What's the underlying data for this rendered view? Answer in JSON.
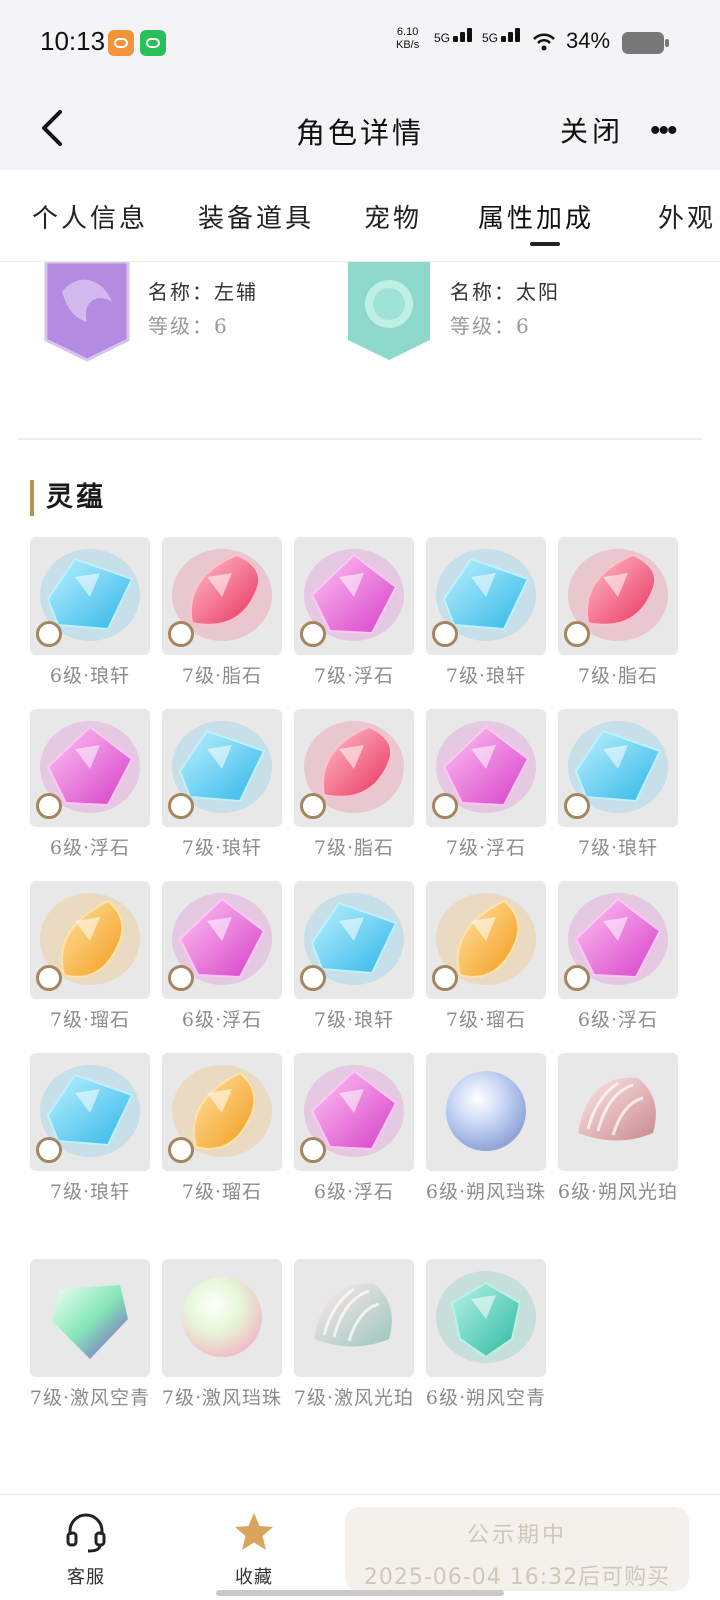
{
  "status_bar": {
    "time": "10:13",
    "net_speed_value": "6.10",
    "net_speed_unit": "KB/s",
    "signal1": "5G",
    "signal2": "5G",
    "battery": "34%"
  },
  "nav": {
    "title": "角色详情",
    "close": "关闭",
    "more": "•••"
  },
  "tabs": [
    "个人信息",
    "装备道具",
    "宠物",
    "属性加成",
    "外观"
  ],
  "active_tab": "属性加成",
  "pets": [
    {
      "name_label": "名称：",
      "name": "左辅",
      "level_label": "等级：",
      "level": "6",
      "color": "#b48be0"
    },
    {
      "name_label": "名称：",
      "name": "太阳",
      "level_label": "等级：",
      "level": "6",
      "color": "#8fd9cc"
    }
  ],
  "section": {
    "title": "灵蕴"
  },
  "gems": [
    {
      "label": "6级·琅轩",
      "kind": "blue"
    },
    {
      "label": "7级·脂石",
      "kind": "red"
    },
    {
      "label": "7级·浮石",
      "kind": "pink"
    },
    {
      "label": "7级·琅轩",
      "kind": "blue"
    },
    {
      "label": "7级·脂石",
      "kind": "red"
    },
    {
      "label": "6级·浮石",
      "kind": "pink"
    },
    {
      "label": "7级·琅轩",
      "kind": "blue"
    },
    {
      "label": "7级·脂石",
      "kind": "red"
    },
    {
      "label": "7级·浮石",
      "kind": "pink"
    },
    {
      "label": "7级·琅轩",
      "kind": "blue"
    },
    {
      "label": "7级·瑠石",
      "kind": "orange"
    },
    {
      "label": "6级·浮石",
      "kind": "pink"
    },
    {
      "label": "7级·琅轩",
      "kind": "blue"
    },
    {
      "label": "7级·瑠石",
      "kind": "orange"
    },
    {
      "label": "6级·浮石",
      "kind": "pink"
    },
    {
      "label": "7级·琅轩",
      "kind": "blue"
    },
    {
      "label": "7级·瑠石",
      "kind": "orange"
    },
    {
      "label": "6级·浮石",
      "kind": "pink"
    },
    {
      "label": "6级·朔风珰珠",
      "kind": "pearl"
    },
    {
      "label": "6级·朔风光珀",
      "kind": "shell"
    },
    {
      "label": "7级·激风空青",
      "kind": "crystal"
    },
    {
      "label": "7级·激风珰珠",
      "kind": "pearl2"
    },
    {
      "label": "7级·激风光珀",
      "kind": "shell2"
    },
    {
      "label": "6级·朔风空青",
      "kind": "teal"
    }
  ],
  "bottom": {
    "service": "客服",
    "favorite": "收藏",
    "cta_line1": "公示期中",
    "cta_line2": "2025-06-04 16:32后可购买"
  },
  "colors": {
    "accent": "#b99059",
    "blue": "#2fb6e8",
    "red": "#e8325a",
    "pink": "#d63ec8",
    "orange": "#f39a18",
    "teal": "#2bb7a0"
  }
}
